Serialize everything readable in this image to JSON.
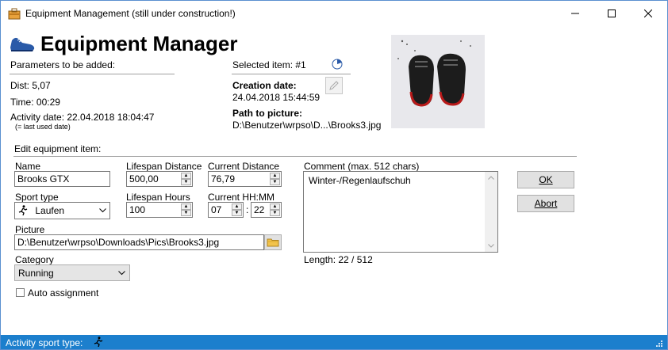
{
  "window": {
    "title": "Equipment Management (still under construction!)"
  },
  "header": {
    "title": "Equipment Manager"
  },
  "params": {
    "heading": "Parameters to be added:",
    "dist": "Dist: 5,07",
    "time": "Time: 00:29",
    "activity_date": "Activity date: 22.04.2018 18:04:47",
    "last_used_note": "(= last used date)"
  },
  "selected": {
    "label": "Selected item: #1",
    "creation_label": "Creation date:",
    "creation_value": "24.04.2018 15:44:59",
    "path_label": "Path to picture:",
    "path_value": "D:\\Benutzer\\wrpso\\D...\\Brooks3.jpg"
  },
  "edit": {
    "heading": "Edit equipment item:",
    "name_label": "Name",
    "name_value": "Brooks GTX",
    "lifespan_distance_label": "Lifespan Distance",
    "lifespan_distance_value": "500,00",
    "current_distance_label": "Current Distance",
    "current_distance_value": "76,79",
    "sport_type_label": "Sport type",
    "sport_type_value": "Laufen",
    "lifespan_hours_label": "Lifespan Hours",
    "lifespan_hours_value": "100",
    "current_hhmm_label": "Current HH:MM",
    "current_hh_value": "07",
    "hhmm_separator": ":",
    "current_mm_value": "22",
    "picture_label": "Picture",
    "picture_value": "D:\\Benutzer\\wrpso\\Downloads\\Pics\\Brooks3.jpg",
    "category_label": "Category",
    "category_value": "Running",
    "auto_assignment_label": "Auto assignment",
    "auto_assignment_checked": false,
    "comment_label": "Comment (max. 512 chars)",
    "comment_value": "Winter-/Regenlaufschuh",
    "length_text": "Length: 22 / 512"
  },
  "buttons": {
    "ok": "OK",
    "abort": "Abort"
  },
  "status": {
    "label": "Activity sport type:"
  },
  "colors": {
    "statusbar": "#1c7fcd",
    "accent_blue": "#2a5aa8"
  }
}
